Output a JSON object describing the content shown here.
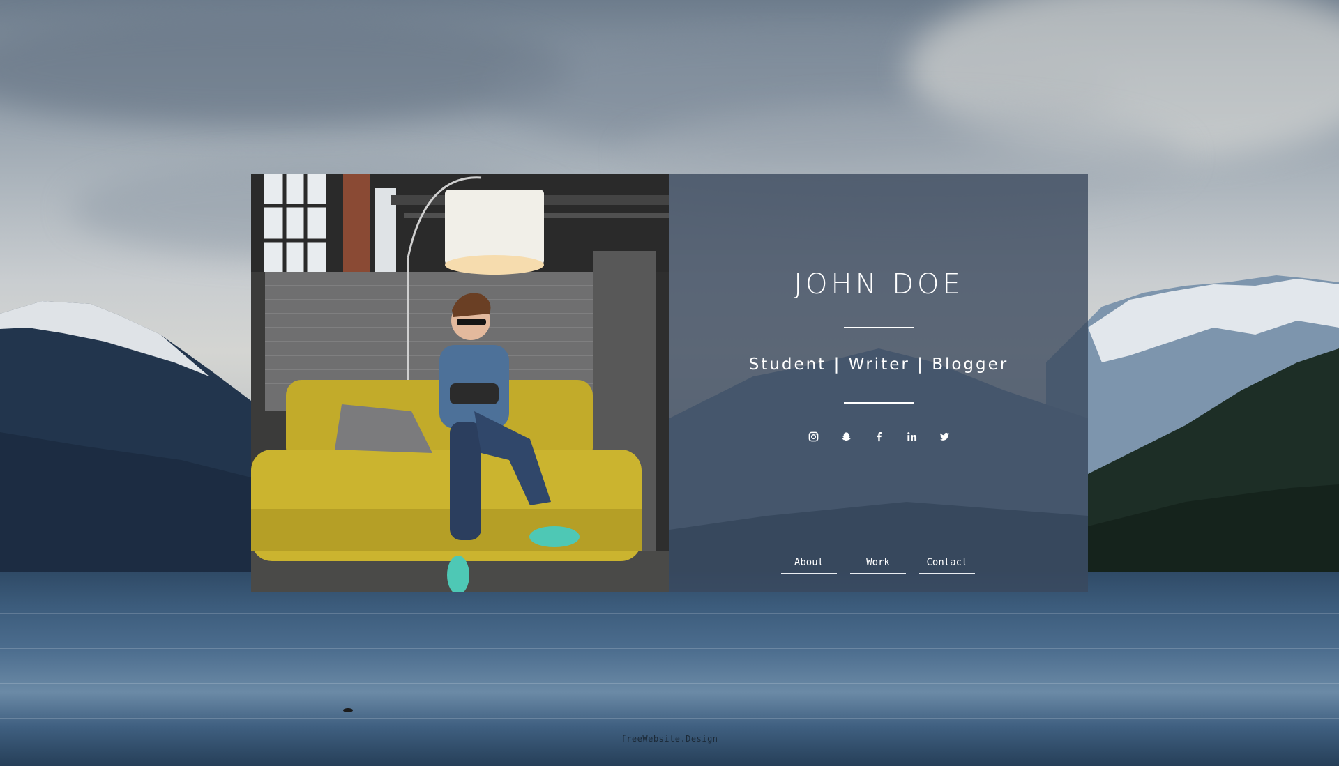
{
  "profile": {
    "name": "JOHN DOE",
    "tagline": "Student | Writer | Blogger"
  },
  "socials": [
    {
      "icon": "instagram-icon"
    },
    {
      "icon": "snapchat-icon"
    },
    {
      "icon": "facebook-icon"
    },
    {
      "icon": "linkedin-icon"
    },
    {
      "icon": "twitter-icon"
    }
  ],
  "nav": {
    "items": [
      {
        "label": "About"
      },
      {
        "label": "Work"
      },
      {
        "label": "Contact"
      }
    ]
  },
  "footer": {
    "credit": "freeWebsite.Design"
  },
  "colors": {
    "info_panel": "#3a485c",
    "text": "#ffffff",
    "sofa": "#c9b32b",
    "lake": "#3c5c7c"
  }
}
